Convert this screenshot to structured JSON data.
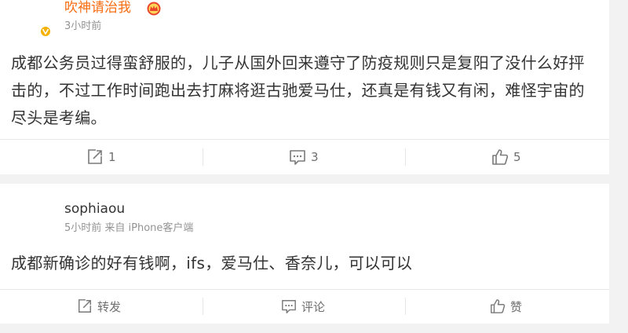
{
  "posts": [
    {
      "username": "吹神请治我",
      "username_color": "#f86d12",
      "time": "3小时前",
      "verified": true,
      "vip_crown": true,
      "content": "成都公务员过得蛮舒服的，儿子从国外回来遵守了防疫规则只是复阳了没什么好抨击的，不过工作时间跑出去打麻将逛古驰爱马仕，还真是有钱又有闲，难怪宇宙的尽头是考编。",
      "actions": {
        "repost": "1",
        "comment": "3",
        "like": "5"
      }
    },
    {
      "username": "sophiaou",
      "username_color": "#333333",
      "time": "5小时前 来自 iPhone客户端",
      "verified": false,
      "vip_crown": false,
      "content": "成都新确诊的好有钱啊，ifs，爱马仕、香奈儿，可以可以",
      "actions": {
        "repost": "转发",
        "comment": "评论",
        "like": "赞"
      }
    }
  ],
  "colors": {
    "page_bg": "#f2f2f2",
    "card_bg": "#ffffff",
    "text": "#333333",
    "meta": "#939393",
    "action": "#6f6f6f",
    "verified_badge": "#f5b100"
  },
  "icons": {
    "verified": "verified-v-badge-icon",
    "crown": "vip-crown-icon",
    "repost": "repost-icon",
    "comment": "comment-icon",
    "like": "thumbs-up-icon"
  }
}
